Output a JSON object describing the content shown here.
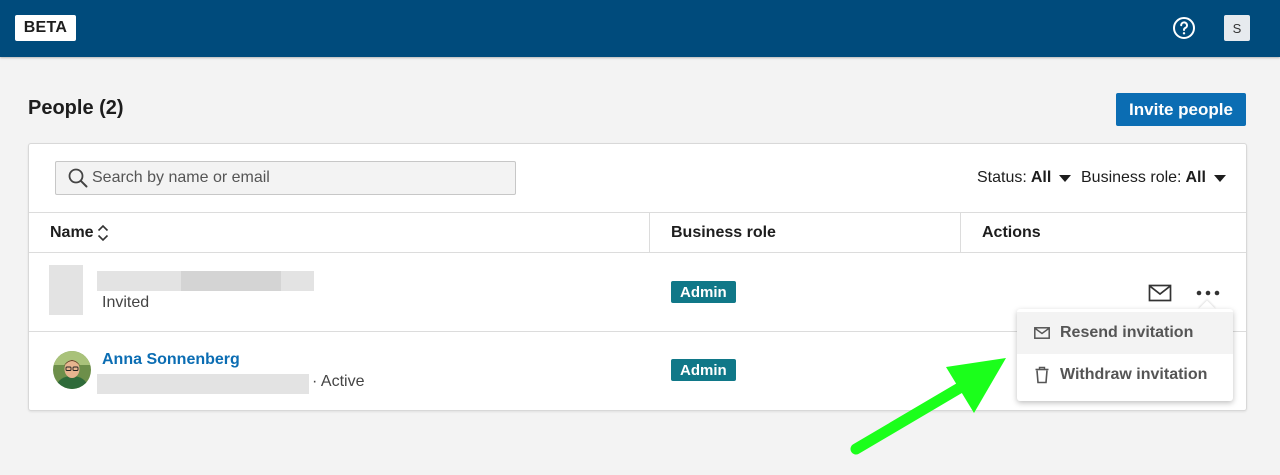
{
  "header": {
    "badge": "BETA",
    "help_icon": "help-circle-icon",
    "user_initial": "S"
  },
  "page": {
    "title": "People (2)",
    "invite_label": "Invite people"
  },
  "search": {
    "placeholder": "Search by name or email",
    "icon": "search-icon"
  },
  "filters": {
    "status_label": "Status:",
    "status_value": "All",
    "role_label": "Business role:",
    "role_value": "All"
  },
  "table": {
    "columns": [
      "Name",
      "Business role",
      "Actions"
    ],
    "rows": [
      {
        "name": "",
        "status": "Invited",
        "role": "Admin"
      },
      {
        "name": "Anna Sonnenberg",
        "status": "· Active",
        "role": "Admin"
      }
    ]
  },
  "menu": {
    "items": [
      {
        "label": "Resend invitation",
        "icon": "envelope-icon"
      },
      {
        "label": "Withdraw invitation",
        "icon": "trash-icon"
      }
    ]
  },
  "colors": {
    "topbar": "#004b7c",
    "primary": "#0b6db3",
    "badge": "#107888",
    "annotation_arrow": "#1bff1b"
  }
}
